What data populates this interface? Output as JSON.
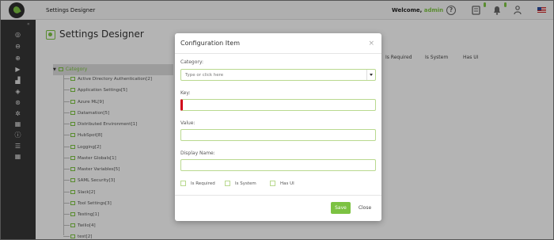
{
  "header": {
    "app_title": "Settings Designer",
    "welcome_text": "Welcome,",
    "user_name": "admin",
    "help_glyph": "?",
    "notif_badge_1": "",
    "notif_badge_2": ""
  },
  "sidebar": {
    "icons": [
      "dashboard-icon",
      "minus-circle-icon",
      "plus-circle-icon",
      "play-icon",
      "chart-icon",
      "tag-icon",
      "search-gear-icon",
      "settings-icon",
      "grid-icon",
      "info-icon",
      "list-icon",
      "apps-icon"
    ]
  },
  "page": {
    "title": "Settings Designer",
    "tree_root": "Category",
    "tree_items": [
      "Active Directory Authentication[2]",
      "Application Settings[5]",
      "Azure ML[9]",
      "Datamation[5]",
      "Distributed Environment[1]",
      "HubSpot[8]",
      "Logging[2]",
      "Master Globals[1]",
      "Master Variables[5]",
      "SAML Security[3]",
      "Slack[2]",
      "Tool Settings[3]",
      "Testing[1]",
      "Twilio[4]",
      "test[2]"
    ],
    "columns": [
      "Is Required",
      "Is System",
      "Has UI"
    ]
  },
  "modal": {
    "title": "Configuration Item",
    "close_glyph": "×",
    "category_label": "Category:",
    "category_placeholder": "Type or click here",
    "key_label": "Key:",
    "value_label": "Value:",
    "display_name_label": "Display Name:",
    "checkbox_required": "Is Required",
    "checkbox_system": "Is System",
    "checkbox_has_ui": "Has UI",
    "save_label": "Save",
    "close_label": "Close"
  },
  "colors": {
    "accent": "#7cc242",
    "sidebar_bg": "#353535",
    "error": "#d0021b"
  }
}
